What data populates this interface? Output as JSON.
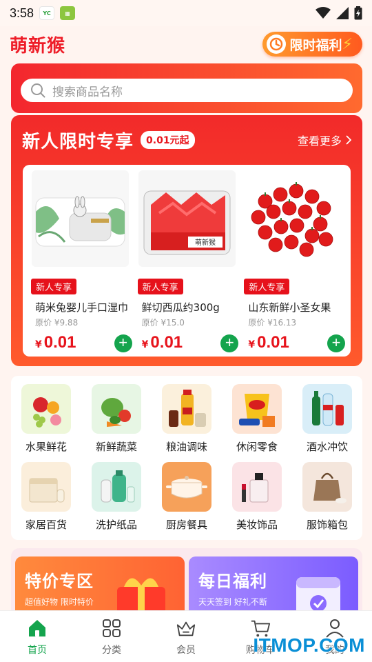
{
  "status_bar": {
    "time": "3:58"
  },
  "header": {
    "brand": "萌新猴",
    "promo_label": "限时福利"
  },
  "search": {
    "placeholder": "搜索商品名称"
  },
  "newbie": {
    "title": "新人限时专享",
    "tag": "0.01元起",
    "more": "查看更多",
    "products": [
      {
        "tag": "新人专享",
        "name": "萌米兔婴儿手口湿巾",
        "orig_label": "原价",
        "orig_price": "¥9.88",
        "price_symbol": "¥",
        "price": "0.01"
      },
      {
        "tag": "新人专享",
        "name": "鲜切西瓜约300g",
        "orig_label": "原价",
        "orig_price": "¥15.0",
        "price_symbol": "¥",
        "price": "0.01"
      },
      {
        "tag": "新人专享",
        "name": "山东新鲜小圣女果",
        "orig_label": "原价",
        "orig_price": "¥16.13",
        "price_symbol": "¥",
        "price": "0.01"
      }
    ]
  },
  "categories": [
    {
      "label": "水果鲜花"
    },
    {
      "label": "新鲜蔬菜"
    },
    {
      "label": "粮油调味"
    },
    {
      "label": "休闲零食"
    },
    {
      "label": "酒水冲饮"
    },
    {
      "label": "家居百货"
    },
    {
      "label": "洗护纸品"
    },
    {
      "label": "厨房餐具"
    },
    {
      "label": "美妆饰品"
    },
    {
      "label": "服饰箱包"
    }
  ],
  "banners": [
    {
      "title": "特价专区",
      "subtitle": "超值好物 限时特价"
    },
    {
      "title": "每日福利",
      "subtitle": "天天签到 好礼不断"
    }
  ],
  "tabbar": [
    {
      "label": "首页"
    },
    {
      "label": "分类"
    },
    {
      "label": "会员"
    },
    {
      "label": "购物车"
    },
    {
      "label": "我的"
    }
  ],
  "watermark": "ITMOP.COM",
  "colors": {
    "brand_red": "#ee1d28",
    "accent_green": "#14a44d",
    "price_red": "#e7141c"
  }
}
